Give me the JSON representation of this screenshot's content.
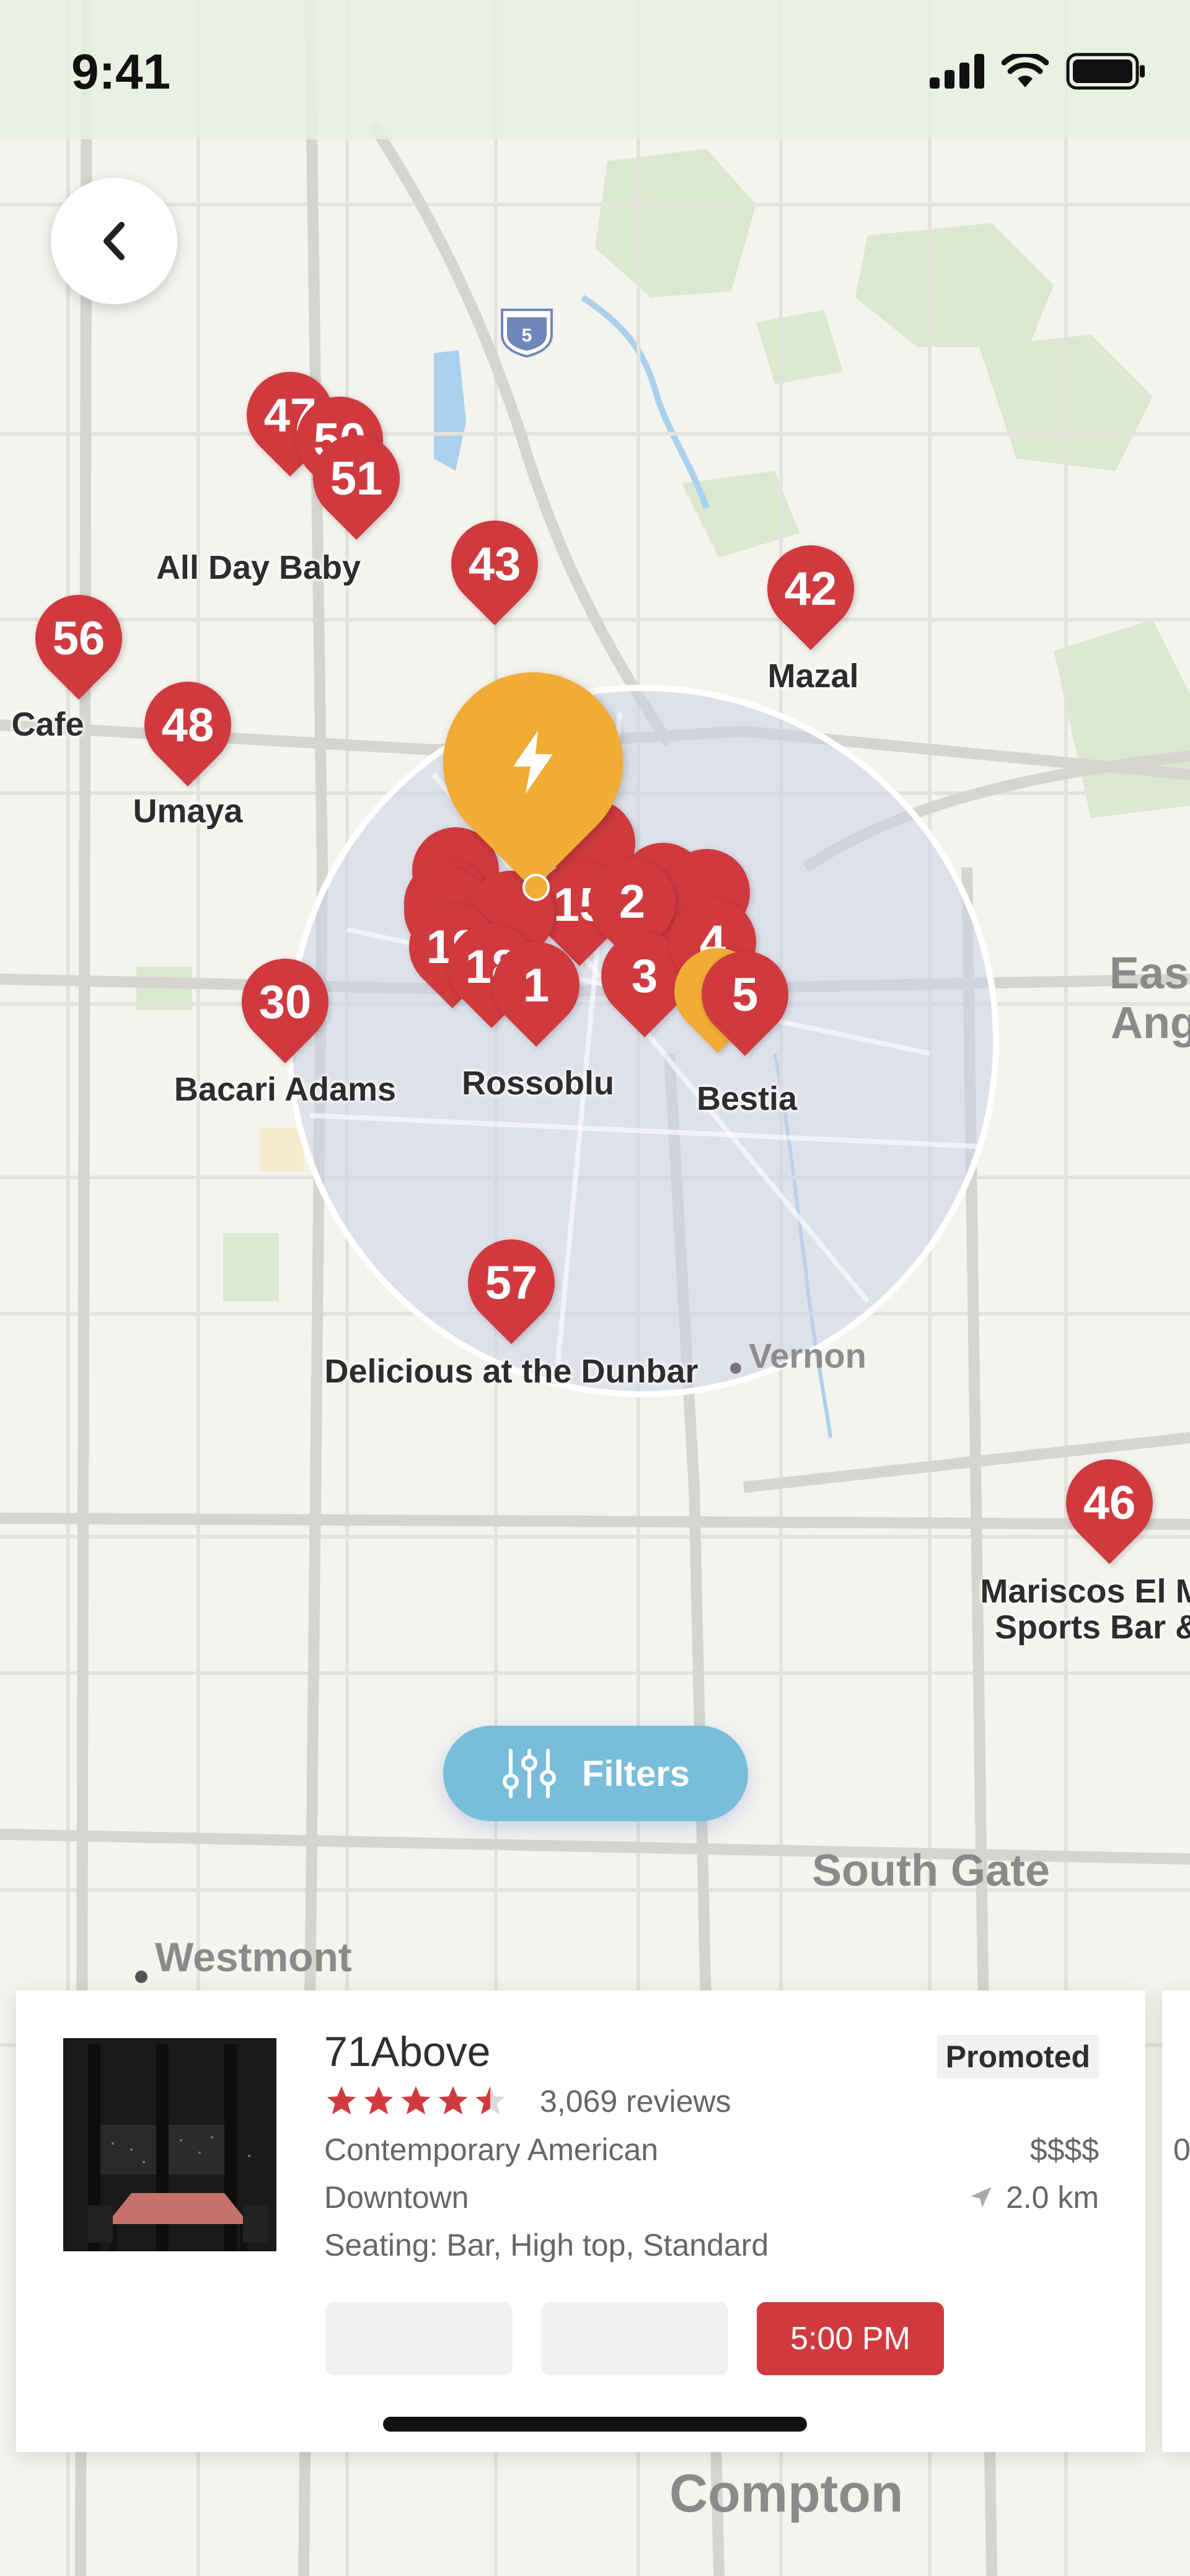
{
  "status_bar": {
    "time": "9:41"
  },
  "map": {
    "pins": [
      {
        "id": "47",
        "label": "47"
      },
      {
        "id": "50",
        "label": "50"
      },
      {
        "id": "51",
        "label": "51"
      },
      {
        "id": "43",
        "label": "43"
      },
      {
        "id": "42",
        "label": "42"
      },
      {
        "id": "56",
        "label": "56"
      },
      {
        "id": "48",
        "label": "48"
      },
      {
        "id": "30",
        "label": "30"
      },
      {
        "id": "15",
        "label": "15"
      },
      {
        "id": "2",
        "label": "2"
      },
      {
        "id": "19",
        "label": "19"
      },
      {
        "id": "18",
        "label": "18"
      },
      {
        "id": "1",
        "label": "1"
      },
      {
        "id": "3",
        "label": "3"
      },
      {
        "id": "4",
        "label": "4"
      },
      {
        "id": "5",
        "label": "5"
      },
      {
        "id": "57",
        "label": "57"
      },
      {
        "id": "46",
        "label": "46"
      }
    ],
    "restaurant_labels": {
      "all_day_baby": "All Day Baby",
      "mazal": "Mazal",
      "cafe": "Cafe",
      "umaya": "Umaya",
      "bacari_adams": "Bacari Adams",
      "rossoblu": "Rossoblu",
      "bestia": "Bestia",
      "delicious": "Delicious at the Dunbar",
      "mariscos_1": "Mariscos El Maz",
      "mariscos_2": "Sports Bar &"
    },
    "area_labels": {
      "east_1": "Eas",
      "east_2": "Ang",
      "vernon": "Vernon",
      "south_gate": "South Gate",
      "westmont": "Westmont",
      "compton": "Compton"
    },
    "highway_shield": "5"
  },
  "filters": {
    "label": "Filters"
  },
  "card": {
    "name": "71Above",
    "promoted": "Promoted",
    "rating": 4.5,
    "reviews": "3,069 reviews",
    "cuisine": "Contemporary American",
    "price": "$$$$",
    "neighborhood": "Downtown",
    "distance": "2.0 km",
    "seating": "Seating: Bar, High top, Standard",
    "time_slots": [
      "",
      "",
      "5:00 PM"
    ]
  },
  "next_card": {
    "price_fragment": "0"
  },
  "colors": {
    "pin_red": "#d03a3f",
    "pin_gold": "#f0ac35",
    "filters_blue": "#78bdd9",
    "map_bg": "#f4f3ee"
  }
}
